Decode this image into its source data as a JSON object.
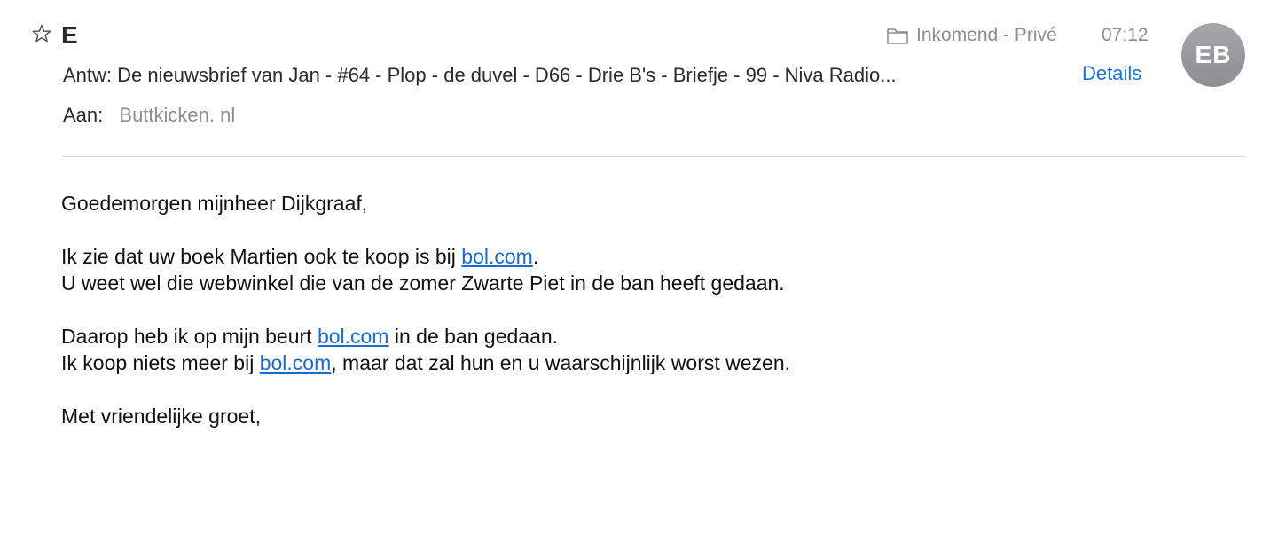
{
  "header": {
    "sender_initials_visible": "E",
    "mailbox_label": "Inkomend - Privé",
    "time": "07:12",
    "avatar_initials": "EB",
    "subject": "Antw: De nieuwsbrief van Jan - #64 - Plop - de duvel - D66 - Drie B's - Briefje - 99 - Niva Radio...",
    "details_label": "Details",
    "to_label": "Aan:",
    "to_value": "Buttkicken. nl"
  },
  "icons": {
    "star": "star-outline-icon",
    "mailbox": "folder-icon"
  },
  "colors": {
    "link": "#1a6bd1",
    "details": "#1a73d9",
    "avatar_bg": "#9a9ba0",
    "muted_text": "#8e8e93"
  },
  "body": {
    "greeting": "Goedemorgen mijnheer Dijkgraaf,",
    "p1_l1_before": "Ik zie dat uw boek Martien ook te koop is bij ",
    "p1_l1_link": "bol.com",
    "p1_l1_after": ".",
    "p1_l2": "U weet wel die webwinkel die van de zomer Zwarte Piet in de ban heeft gedaan.",
    "p2_l1_before": "Daarop heb ik op mijn beurt ",
    "p2_l1_link": "bol.com",
    "p2_l1_after": " in de ban gedaan.",
    "p2_l2_before": "Ik koop niets meer bij ",
    "p2_l2_link": "bol.com",
    "p2_l2_after": ", maar dat zal hun en u waarschijnlijk worst wezen.",
    "closing": "Met vriendelijke groet,"
  }
}
